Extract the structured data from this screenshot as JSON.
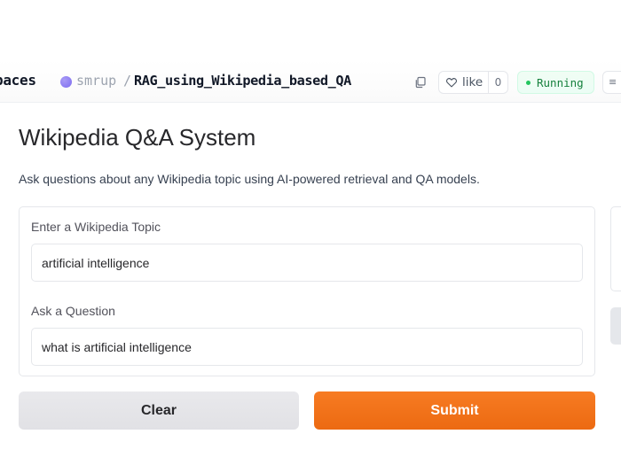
{
  "header": {
    "spaces_label": "paces",
    "owner": "smrup",
    "separator": "/",
    "repo": "RAG_using_Wikipedia_based_QA",
    "like_label": "like",
    "like_count": "0",
    "status": "Running",
    "status_color": "#22c55e",
    "owner_avatar_color": "#8b7cf6"
  },
  "app": {
    "title": "Wikipedia Q&A System",
    "description": "Ask questions about any Wikipedia topic using AI-powered retrieval and QA models.",
    "topic": {
      "label": "Enter a Wikipedia Topic",
      "value": "artificial intelligence"
    },
    "question": {
      "label": "Ask a Question",
      "value": "what is artificial intelligence"
    },
    "clear_label": "Clear",
    "submit_label": "Submit",
    "accent_color": "#f26f1a"
  }
}
